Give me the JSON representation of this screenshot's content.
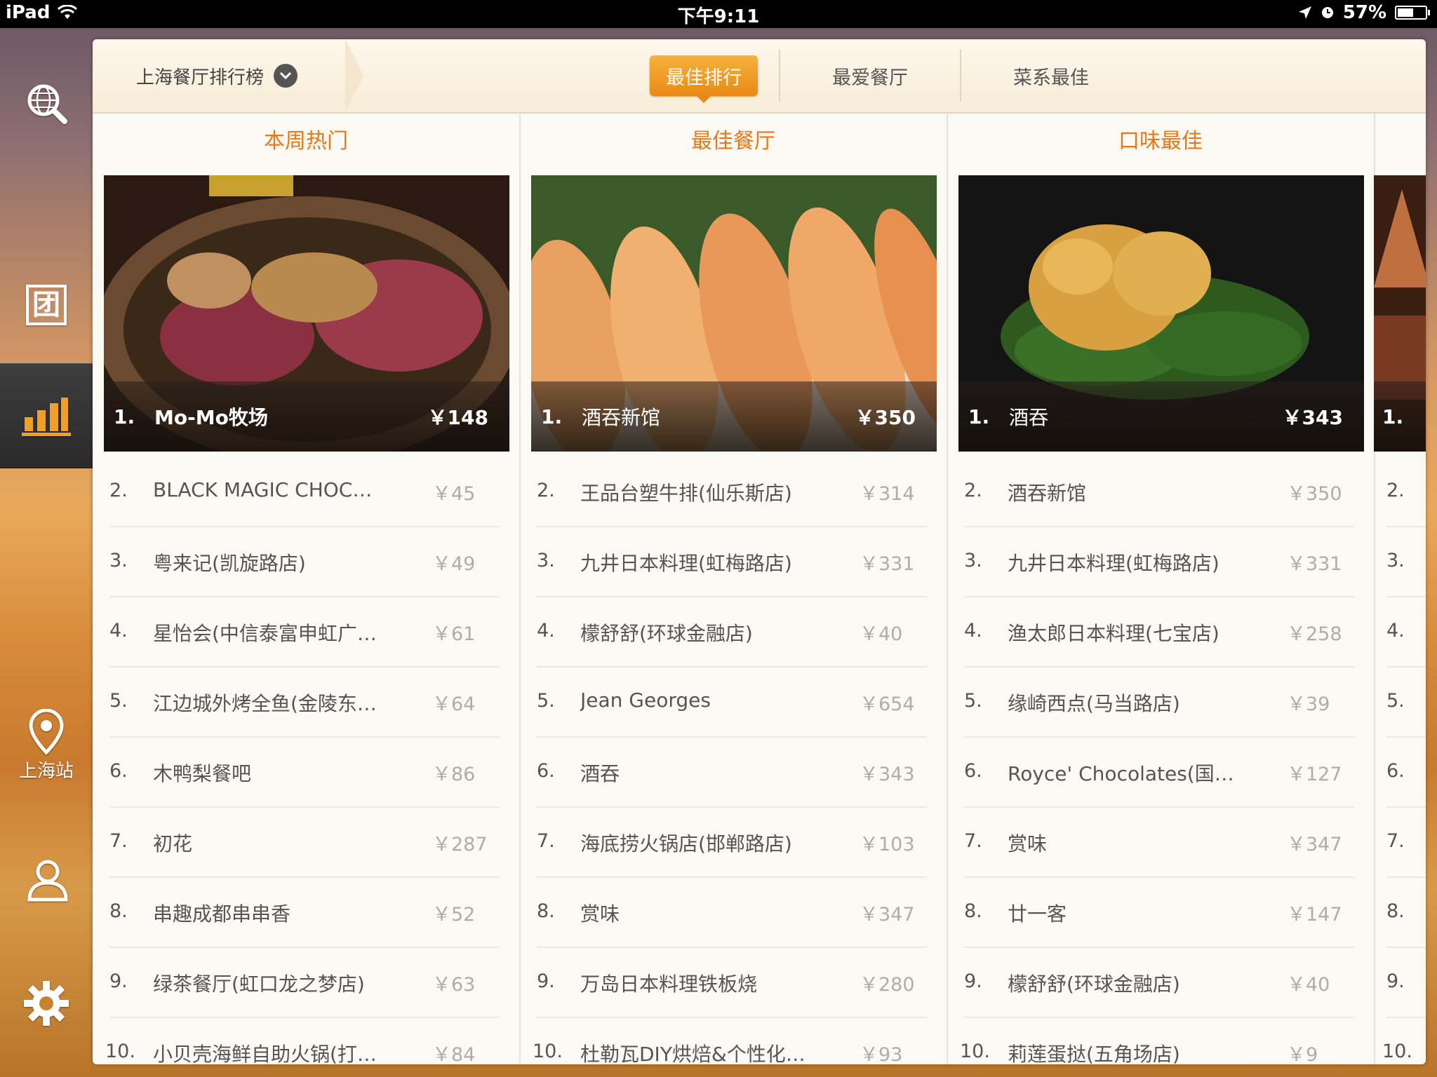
{
  "status_bar": {
    "device": "iPad",
    "time": "下午9:11",
    "battery_percent": "57%",
    "battery_level": 0.57
  },
  "sidebar": {
    "items": [
      {
        "icon": "globe-search-icon"
      },
      {
        "icon": "group-buy-icon",
        "glyph": "团"
      },
      {
        "icon": "ranking-chart-icon",
        "active": true
      },
      {
        "icon": "location-pin-icon",
        "label": "上海站"
      },
      {
        "icon": "user-icon"
      },
      {
        "icon": "gear-icon"
      }
    ]
  },
  "topbar": {
    "city": "上海餐厅排行榜",
    "tabs": [
      {
        "label": "最佳排行",
        "active": true
      },
      {
        "label": "最爱餐厅"
      },
      {
        "label": "菜系最佳"
      }
    ]
  },
  "columns": [
    {
      "title": "本周热门",
      "hero": {
        "rank": "1.",
        "name": "Mo-Mo牧场",
        "price": "￥148"
      },
      "rows": [
        {
          "rank": "2.",
          "name": "BLACK MAGIC CHOC…",
          "price": "￥45"
        },
        {
          "rank": "3.",
          "name": "粤来记(凯旋路店)",
          "price": "￥49"
        },
        {
          "rank": "4.",
          "name": "星怡会(中信泰富申虹广…",
          "price": "￥61"
        },
        {
          "rank": "5.",
          "name": "江边城外烤全鱼(金陵东…",
          "price": "￥64"
        },
        {
          "rank": "6.",
          "name": "木鸭梨餐吧",
          "price": "￥86"
        },
        {
          "rank": "7.",
          "name": "初花",
          "price": "￥287"
        },
        {
          "rank": "8.",
          "name": "串趣成都串串香",
          "price": "￥52"
        },
        {
          "rank": "9.",
          "name": "绿茶餐厅(虹口龙之梦店)",
          "price": "￥63"
        },
        {
          "rank": "10.",
          "name": "小贝壳海鲜自助火锅(打…",
          "price": "￥84"
        }
      ]
    },
    {
      "title": "最佳餐厅",
      "hero": {
        "rank": "1.",
        "name": "酒吞新馆",
        "price": "￥350"
      },
      "rows": [
        {
          "rank": "2.",
          "name": "王品台塑牛排(仙乐斯店)",
          "price": "￥314"
        },
        {
          "rank": "3.",
          "name": "九井日本料理(虹梅路店)",
          "price": "￥331"
        },
        {
          "rank": "4.",
          "name": "檬舒舒(环球金融店)",
          "price": "￥40"
        },
        {
          "rank": "5.",
          "name": "Jean Georges",
          "price": "￥654"
        },
        {
          "rank": "6.",
          "name": "酒吞",
          "price": "￥343"
        },
        {
          "rank": "7.",
          "name": "海底捞火锅店(邯郸路店)",
          "price": "￥103"
        },
        {
          "rank": "8.",
          "name": "赏味",
          "price": "￥347"
        },
        {
          "rank": "9.",
          "name": "万岛日本料理铁板烧",
          "price": "￥280"
        },
        {
          "rank": "10.",
          "name": "杜勒瓦DIY烘焙&个性化…",
          "price": "￥93"
        }
      ]
    },
    {
      "title": "口味最佳",
      "hero": {
        "rank": "1.",
        "name": "酒吞",
        "price": "￥343"
      },
      "rows": [
        {
          "rank": "2.",
          "name": "酒吞新馆",
          "price": "￥350"
        },
        {
          "rank": "3.",
          "name": "九井日本料理(虹梅路店)",
          "price": "￥331"
        },
        {
          "rank": "4.",
          "name": "渔太郎日本料理(七宝店)",
          "price": "￥258"
        },
        {
          "rank": "5.",
          "name": "缘崎西点(马当路店)",
          "price": "￥39"
        },
        {
          "rank": "6.",
          "name": "Royce' Chocolates(国…",
          "price": "￥127"
        },
        {
          "rank": "7.",
          "name": "赏味",
          "price": "￥347"
        },
        {
          "rank": "8.",
          "name": "廿一客",
          "price": "￥147"
        },
        {
          "rank": "9.",
          "name": "檬舒舒(环球金融店)",
          "price": "￥40"
        },
        {
          "rank": "10.",
          "name": "莉莲蛋挞(五角场店)",
          "price": "￥9"
        }
      ]
    }
  ],
  "peek_column": {
    "ranks": [
      "1.",
      "2.",
      "3.",
      "4.",
      "5.",
      "6.",
      "7.",
      "8.",
      "9.",
      "10."
    ]
  },
  "colors": {
    "accent": "#e87818",
    "tab_active": "#f0a028",
    "panel_bg": "#fbf9f4"
  }
}
